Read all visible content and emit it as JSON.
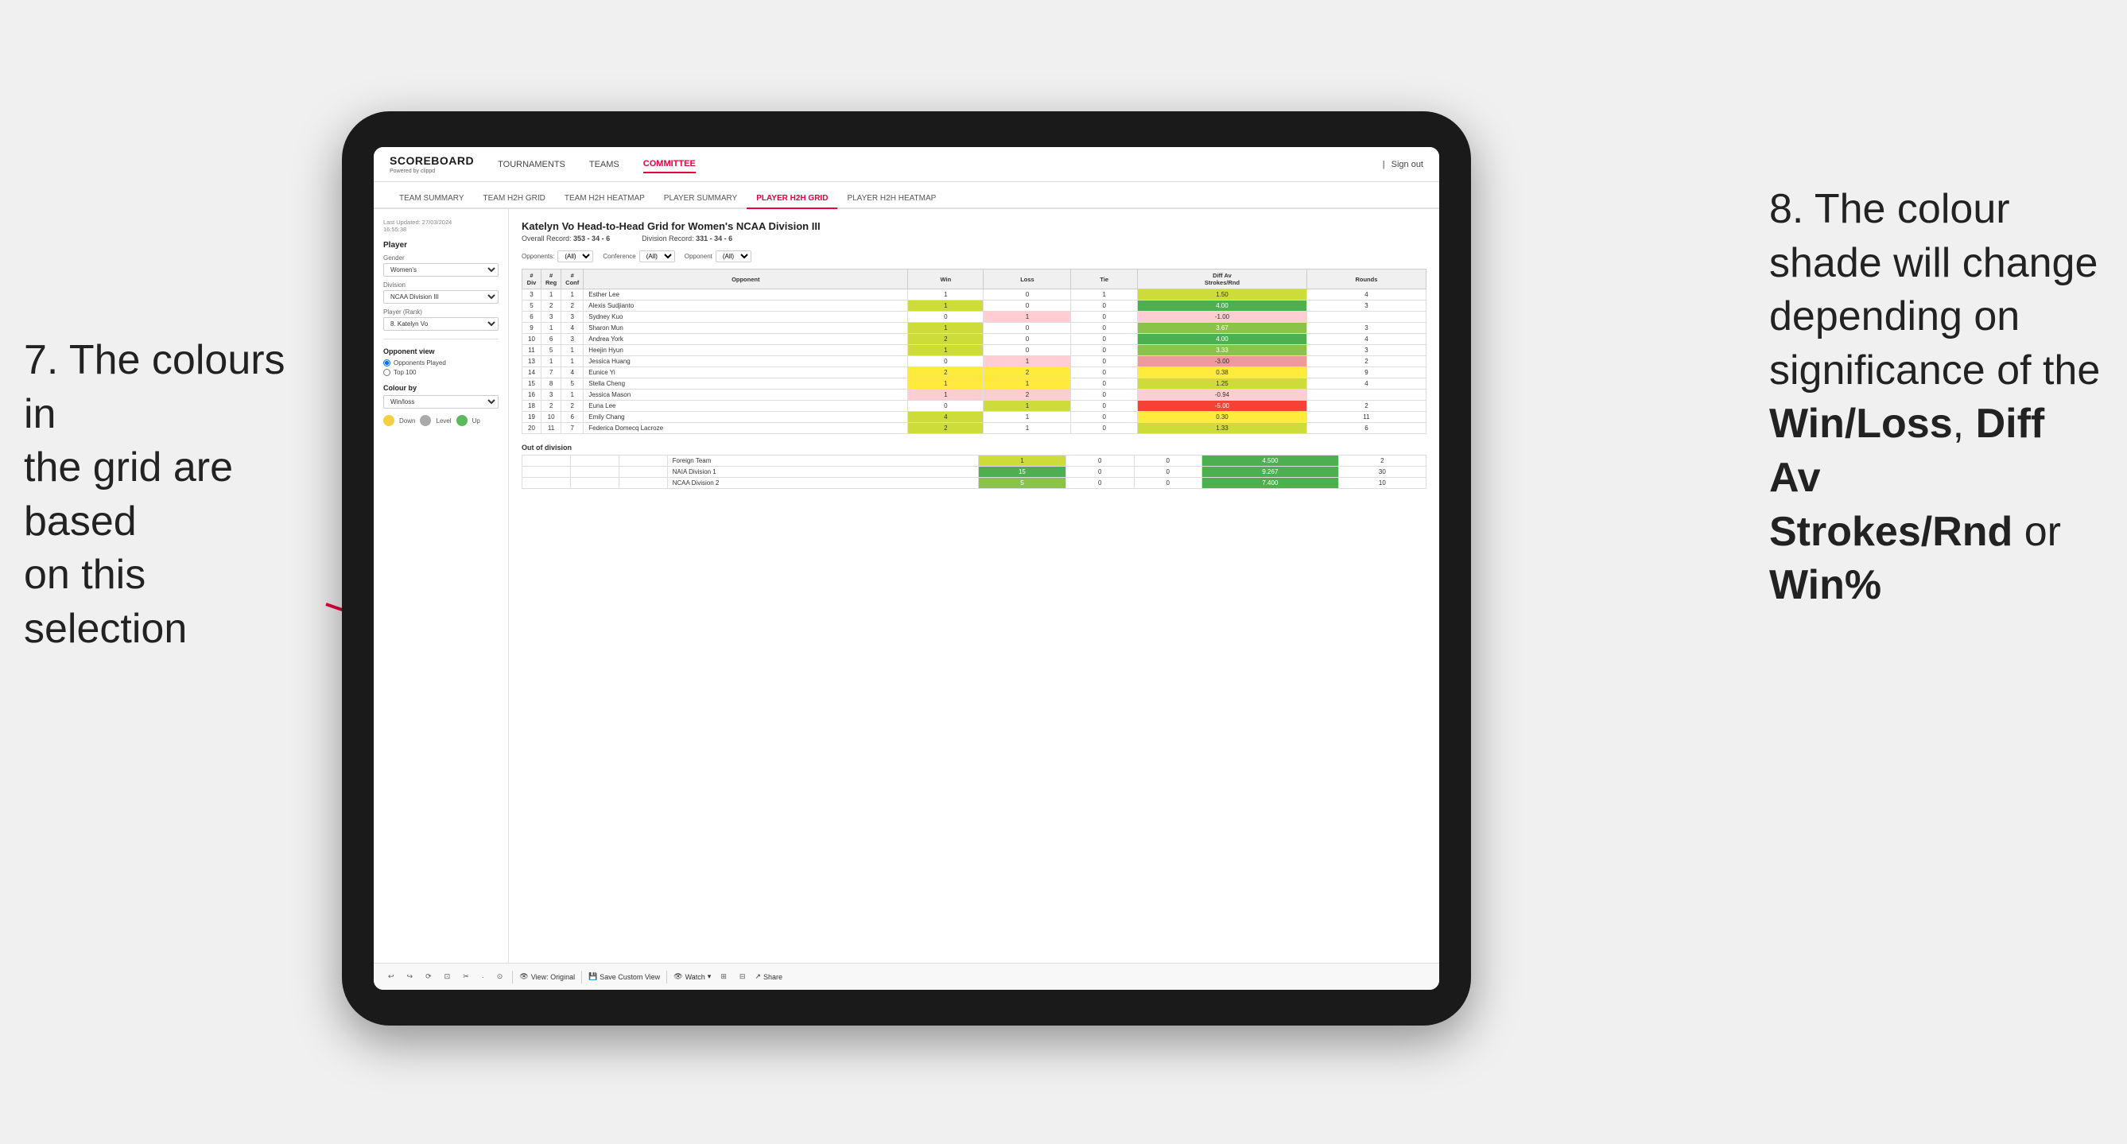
{
  "page": {
    "background": "#f0f0f0"
  },
  "annotation_left": {
    "line1": "7. The colours in",
    "line2": "the grid are based",
    "line3": "on this selection"
  },
  "annotation_right": {
    "line1": "8. The colour",
    "line2": "shade will change",
    "line3": "depending on",
    "line4": "significance of the",
    "bold1": "Win/Loss",
    "comma1": ", ",
    "bold2": "Diff Av",
    "line5": "Strokes/Rnd",
    "line6": " or",
    "bold3": "Win%"
  },
  "nav": {
    "logo": "SCOREBOARD",
    "logo_sub": "Powered by clippd",
    "items": [
      "TOURNAMENTS",
      "TEAMS",
      "COMMITTEE"
    ],
    "active": "COMMITTEE",
    "right_items": [
      "Sign out"
    ]
  },
  "sub_nav": {
    "items": [
      "TEAM SUMMARY",
      "TEAM H2H GRID",
      "TEAM H2H HEATMAP",
      "PLAYER SUMMARY",
      "PLAYER H2H GRID",
      "PLAYER H2H HEATMAP"
    ],
    "active": "PLAYER H2H GRID"
  },
  "sidebar": {
    "last_updated_label": "Last Updated: 27/03/2024",
    "last_updated_time": "16:55:38",
    "section_title": "Player",
    "gender_label": "Gender",
    "gender_value": "Women's",
    "division_label": "Division",
    "division_value": "NCAA Division III",
    "player_rank_label": "Player (Rank)",
    "player_rank_value": "8. Katelyn Vo",
    "opponent_view_title": "Opponent view",
    "opponents_played_label": "Opponents Played",
    "top100_label": "Top 100",
    "colour_by_label": "Colour by",
    "colour_by_value": "Win/loss",
    "legend": [
      {
        "color": "#f4d03f",
        "label": "Down"
      },
      {
        "color": "#aaa",
        "label": "Level"
      },
      {
        "color": "#5cb85c",
        "label": "Up"
      }
    ]
  },
  "grid": {
    "title": "Katelyn Vo Head-to-Head Grid for Women's NCAA Division III",
    "overall_record_label": "Overall Record:",
    "overall_record": "353 - 34 - 6",
    "division_record_label": "Division Record:",
    "division_record": "331 - 34 - 6",
    "opponents_label": "Opponents:",
    "opponents_value": "(All)",
    "conference_label": "Conference",
    "conference_value": "(All)",
    "opponent_label": "Opponent",
    "opponent_value": "(All)",
    "columns": [
      "#\nDiv",
      "#\nReg",
      "#\nConf",
      "Opponent",
      "Win",
      "Loss",
      "Tie",
      "Diff Av\nStrokes/Rnd",
      "Rounds"
    ],
    "rows": [
      {
        "div": "3",
        "reg": "1",
        "conf": "1",
        "opponent": "Esther Lee",
        "win": 1,
        "loss": 0,
        "tie": 1,
        "diff": "1.50",
        "rounds": "4",
        "win_class": "cell-white",
        "loss_class": "cell-white",
        "diff_class": "cell-green-light"
      },
      {
        "div": "5",
        "reg": "2",
        "conf": "2",
        "opponent": "Alexis Sudjianto",
        "win": 1,
        "loss": 0,
        "tie": 0,
        "diff": "4.00",
        "rounds": "3",
        "win_class": "cell-green-light",
        "loss_class": "cell-white",
        "diff_class": "cell-green-dark"
      },
      {
        "div": "6",
        "reg": "3",
        "conf": "3",
        "opponent": "Sydney Kuo",
        "win": 0,
        "loss": 1,
        "tie": 0,
        "diff": "-1.00",
        "rounds": "",
        "win_class": "cell-white",
        "loss_class": "cell-red-light",
        "diff_class": "cell-red-light"
      },
      {
        "div": "9",
        "reg": "1",
        "conf": "4",
        "opponent": "Sharon Mun",
        "win": 1,
        "loss": 0,
        "tie": 0,
        "diff": "3.67",
        "rounds": "3",
        "win_class": "cell-green-light",
        "loss_class": "cell-white",
        "diff_class": "cell-green-med"
      },
      {
        "div": "10",
        "reg": "6",
        "conf": "3",
        "opponent": "Andrea York",
        "win": 2,
        "loss": 0,
        "tie": 0,
        "diff": "4.00",
        "rounds": "4",
        "win_class": "cell-green-light",
        "loss_class": "cell-white",
        "diff_class": "cell-green-dark"
      },
      {
        "div": "11",
        "reg": "5",
        "conf": "1",
        "opponent": "Heejin Hyun",
        "win": 1,
        "loss": 0,
        "tie": 0,
        "diff": "3.33",
        "rounds": "3",
        "win_class": "cell-green-light",
        "loss_class": "cell-white",
        "diff_class": "cell-green-med"
      },
      {
        "div": "13",
        "reg": "1",
        "conf": "1",
        "opponent": "Jessica Huang",
        "win": 0,
        "loss": 1,
        "tie": 0,
        "diff": "-3.00",
        "rounds": "2",
        "win_class": "cell-white",
        "loss_class": "cell-red-light",
        "diff_class": "cell-red-med"
      },
      {
        "div": "14",
        "reg": "7",
        "conf": "4",
        "opponent": "Eunice Yi",
        "win": 2,
        "loss": 2,
        "tie": 0,
        "diff": "0.38",
        "rounds": "9",
        "win_class": "cell-yellow",
        "loss_class": "cell-yellow",
        "diff_class": "cell-yellow"
      },
      {
        "div": "15",
        "reg": "8",
        "conf": "5",
        "opponent": "Stella Cheng",
        "win": 1,
        "loss": 1,
        "tie": 0,
        "diff": "1.25",
        "rounds": "4",
        "win_class": "cell-yellow",
        "loss_class": "cell-yellow",
        "diff_class": "cell-green-light"
      },
      {
        "div": "16",
        "reg": "3",
        "conf": "1",
        "opponent": "Jessica Mason",
        "win": 1,
        "loss": 2,
        "tie": 0,
        "diff": "-0.94",
        "rounds": "",
        "win_class": "cell-red-light",
        "loss_class": "cell-red-light",
        "diff_class": "cell-red-light"
      },
      {
        "div": "18",
        "reg": "2",
        "conf": "2",
        "opponent": "Euna Lee",
        "win": 0,
        "loss": 1,
        "tie": 0,
        "diff": "-5.00",
        "rounds": "2",
        "win_class": "cell-white",
        "loss_class": "cell-green-light",
        "diff_class": "cell-red-dark"
      },
      {
        "div": "19",
        "reg": "10",
        "conf": "6",
        "opponent": "Emily Chang",
        "win": 4,
        "loss": 1,
        "tie": 0,
        "diff": "0.30",
        "rounds": "11",
        "win_class": "cell-green-light",
        "loss_class": "cell-white",
        "diff_class": "cell-yellow"
      },
      {
        "div": "20",
        "reg": "11",
        "conf": "7",
        "opponent": "Federica Domecq Lacroze",
        "win": 2,
        "loss": 1,
        "tie": 0,
        "diff": "1.33",
        "rounds": "6",
        "win_class": "cell-green-light",
        "loss_class": "cell-white",
        "diff_class": "cell-green-light"
      }
    ],
    "out_of_division_label": "Out of division",
    "out_of_division_rows": [
      {
        "opponent": "Foreign Team",
        "win": 1,
        "loss": 0,
        "tie": 0,
        "diff": "4.500",
        "rounds": "2",
        "win_class": "cell-green-light",
        "diff_class": "cell-green-dark"
      },
      {
        "opponent": "NAIA Division 1",
        "win": 15,
        "loss": 0,
        "tie": 0,
        "diff": "9.267",
        "rounds": "30",
        "win_class": "cell-green-dark",
        "diff_class": "cell-green-dark"
      },
      {
        "opponent": "NCAA Division 2",
        "win": 5,
        "loss": 0,
        "tie": 0,
        "diff": "7.400",
        "rounds": "10",
        "win_class": "cell-green-med",
        "diff_class": "cell-green-dark"
      }
    ]
  },
  "toolbar": {
    "buttons": [
      "↩",
      "↪",
      "⟳",
      "⊡",
      "✂",
      "·",
      "⊙"
    ],
    "view_original": "View: Original",
    "save_custom": "Save Custom View",
    "watch": "Watch",
    "share": "Share"
  }
}
